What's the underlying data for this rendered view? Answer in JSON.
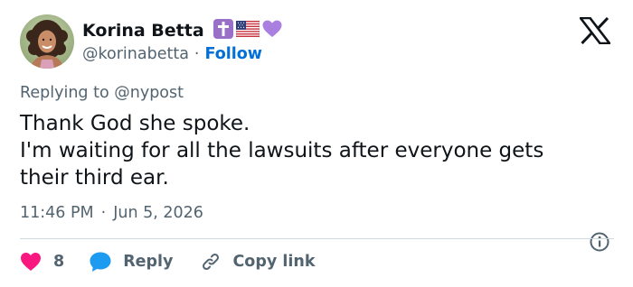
{
  "user": {
    "display_name": "Korina Betta",
    "handle": "@korinabetta",
    "separator": "·",
    "follow_label": "Follow",
    "avatar": "profile-photo",
    "badges": [
      "latin-cross-icon",
      "us-flag-icon",
      "purple-heart-icon"
    ]
  },
  "logo": "x-logo-icon",
  "reply_context": {
    "prefix": "Replying to",
    "mention": "@nypost"
  },
  "tweet": {
    "lines": [
      "Thank God she spoke.",
      "I'm waiting for all the lawsuits after everyone gets",
      "their third ear."
    ]
  },
  "meta": {
    "time": "11:46 PM",
    "separator": "·",
    "date": "Jun 5, 2026",
    "info_icon": "info-icon"
  },
  "actions": {
    "like_count": "8",
    "reply_label": "Reply",
    "copy_label": "Copy link"
  },
  "colors": {
    "text": "#0f1419",
    "secondary": "#536471",
    "link": "#006fd6",
    "like": "#f91880",
    "reply": "#1d9bf0",
    "divider": "#cfd9de",
    "badge_purple": "#9a6fc7"
  }
}
